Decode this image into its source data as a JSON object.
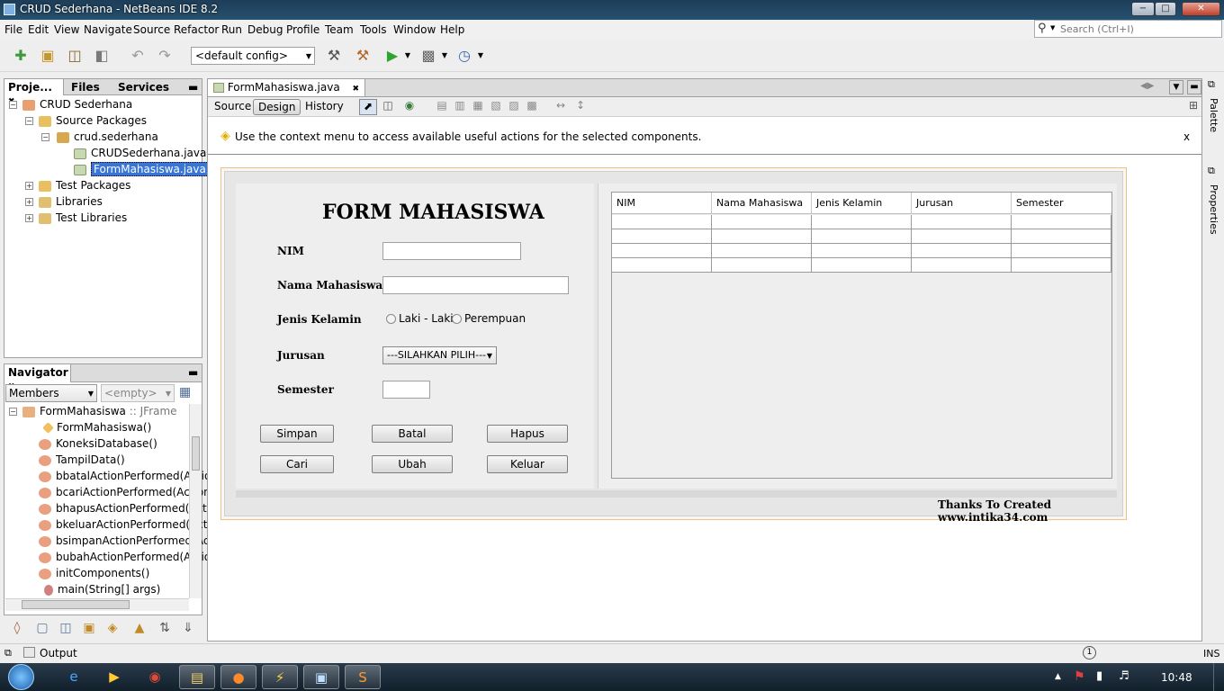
{
  "window": {
    "title": "CRUD Sederhana - NetBeans IDE 8.2",
    "minimize": "−",
    "maximize": "□",
    "close": "✕"
  },
  "menubar": {
    "items": [
      "File",
      "Edit",
      "View",
      "Navigate",
      "Source",
      "Refactor",
      "Run",
      "Debug",
      "Profile",
      "Team",
      "Tools",
      "Window",
      "Help"
    ],
    "search_placeholder": "Search (Ctrl+I)"
  },
  "toolbar": {
    "config_value": "<default config>"
  },
  "projects_panel": {
    "tabs": [
      "Proje...",
      "Files",
      "Services"
    ],
    "tree": [
      {
        "label": "CRUD Sederhana"
      },
      {
        "label": "Source Packages"
      },
      {
        "label": "crud.sederhana"
      },
      {
        "label": "CRUDSederhana.java"
      },
      {
        "label": "FormMahasiswa.java"
      },
      {
        "label": "Test Packages"
      },
      {
        "label": "Libraries"
      },
      {
        "label": "Test Libraries"
      }
    ]
  },
  "navigator": {
    "title": "Navigator",
    "filter_value": "Members",
    "empty_value": "<empty>",
    "root": "FormMahasiswa",
    "root_suffix": ":: JFrame",
    "members": [
      "FormMahasiswa()",
      "KoneksiDatabase()",
      "TampilData()",
      "bbatalActionPerformed(Action",
      "bcariActionPerformed(ActionE",
      "bhapusActionPerformed(Actic",
      "bkeluarActionPerformed(Actic",
      "bsimpanActionPerformed(Acti",
      "bubahActionPerformed(Actior",
      "initComponents()",
      "main(String[] args)"
    ]
  },
  "editor": {
    "file_tab": "FormMahasiswa.java",
    "view_tabs": [
      "Source",
      "Design",
      "History"
    ],
    "hint": "Use the context menu to access available useful actions for the selected components.",
    "hint_close": "x"
  },
  "form": {
    "title": "FORM MAHASISWA",
    "labels": {
      "nim": "NIM",
      "nama": "Nama Mahasiswa",
      "jenis_kelamin": "Jenis Kelamin",
      "jurusan": "Jurusan",
      "semester": "Semester"
    },
    "radio_laki": "Laki - Laki",
    "radio_perempuan": "Perempuan",
    "jurusan_value": "---SILAHKAN PILIH---",
    "buttons": {
      "simpan": "Simpan",
      "batal": "Batal",
      "hapus": "Hapus",
      "cari": "Cari",
      "ubah": "Ubah",
      "keluar": "Keluar"
    },
    "table_columns": [
      "NIM",
      "Nama Mahasiswa",
      "Jenis Kelamin",
      "Jurusan",
      "Semester"
    ],
    "footer": "Thanks To Created www.intika34.com"
  },
  "right_strip": {
    "palette": "Palette",
    "properties": "Properties"
  },
  "output_bar": {
    "label": "Output",
    "mode": "INS"
  },
  "taskbar": {
    "clock": "10:48"
  }
}
